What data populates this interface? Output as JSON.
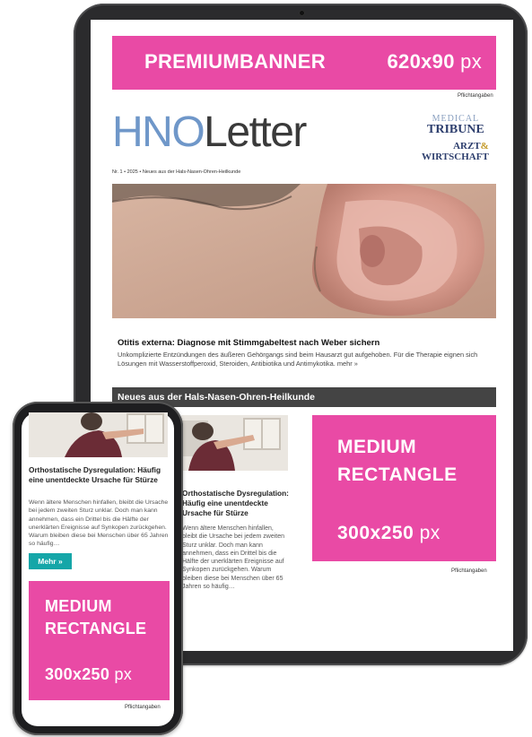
{
  "tablet": {
    "premium_banner": {
      "label": "PREMIUMBANNER",
      "size": "620x90",
      "unit": "px"
    },
    "pflicht_top": "Pflichtangaben",
    "logo": {
      "part1": "HNO",
      "part2": "Letter"
    },
    "partner_logos": {
      "medical": "MEDICAL",
      "tribune": "TRIBUNE",
      "arzt": "ARZT",
      "amp": "&",
      "wirtschaft": "WIRTSCHAFT"
    },
    "issue_line": "Nr. 1 • 2025 • Neues aus der Hals-Nasen-Ohren-Heilkunde",
    "article": {
      "title": "Otitis externa: Diagnose mit Stimmgabeltest nach Weber sichern",
      "text": "Unkomplizierte Entzündungen des äußeren Gehörgangs sind beim Hausarzt gut aufgehoben. Für die Therapie eignen sich Lösungen mit Wasserstoffperoxid, Steroiden, Antibiotika und Antimykotika. mehr »"
    },
    "section_title": "Neues aus der Hals-Nasen-Ohren-Heilkunde",
    "teaser": {
      "title": "Orthostatische Dysregulation: Häufig eine unentdeckte Ursache für Stürze",
      "text": "Wenn ältere Menschen hinfallen, bleibt die Ursache bei jedem zweiten Sturz unklar. Doch man kann annehmen, dass ein Drittel bis die Hälfte der unerklärten Ereignisse auf Synkopen zurückgehen. Warum bleiben diese bei Menschen über 65 Jahren so häufig…"
    },
    "medium_rectangle": {
      "line1": "MEDIUM",
      "line2": "RECTANGLE",
      "size": "300x250",
      "unit": "px"
    },
    "pflicht_bottom": "Pflichtangaben"
  },
  "phone": {
    "teaser": {
      "title": "Orthostatische Dysregulation: Häufig eine unentdeckte Ursache für Stürze",
      "text": "Wenn ältere Menschen hinfallen, bleibt die Ursache bei jedem zweiten Sturz unklar. Doch man kann annehmen, dass ein Drittel bis die Hälfte der unerklärten Ereignisse auf Synkopen zurückgehen. Warum bleiben diese bei Menschen über 65 Jahren so häufig…"
    },
    "more_button": "Mehr »",
    "medium_rectangle": {
      "line1": "MEDIUM",
      "line2": "RECTANGLE",
      "size": "300x250",
      "unit": "px"
    },
    "pflicht": "Pflichtangaben"
  },
  "colors": {
    "ad_pink": "#e94aa5",
    "logo_blue": "#6f97c9",
    "section_bar": "#444444",
    "button_teal": "#15a6a8"
  }
}
